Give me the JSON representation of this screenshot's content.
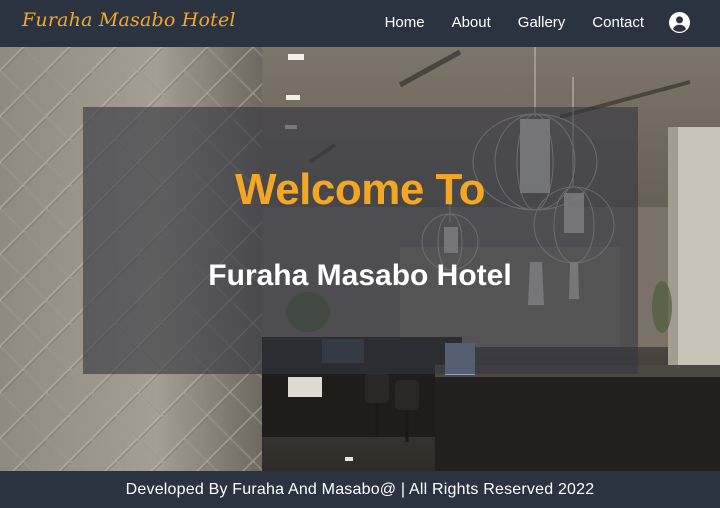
{
  "navbar": {
    "brand": "Furaha Masabo Hotel",
    "links": [
      {
        "label": "Home"
      },
      {
        "label": "About"
      },
      {
        "label": "Gallery"
      },
      {
        "label": "Contact"
      }
    ],
    "user_icon": "user-circle-icon"
  },
  "hero": {
    "title": "Welcome To",
    "subtitle": "Furaha Masabo Hotel",
    "background_image": "hotel-lobby-reception-photo"
  },
  "footer": {
    "text": "Developed By Furaha And Masabo@ | All Rights Reserved 2022"
  },
  "colors": {
    "nav_bg": "#2c3340",
    "brand": "#f2a82a",
    "accent": "#f5a623",
    "text": "#ffffff"
  }
}
